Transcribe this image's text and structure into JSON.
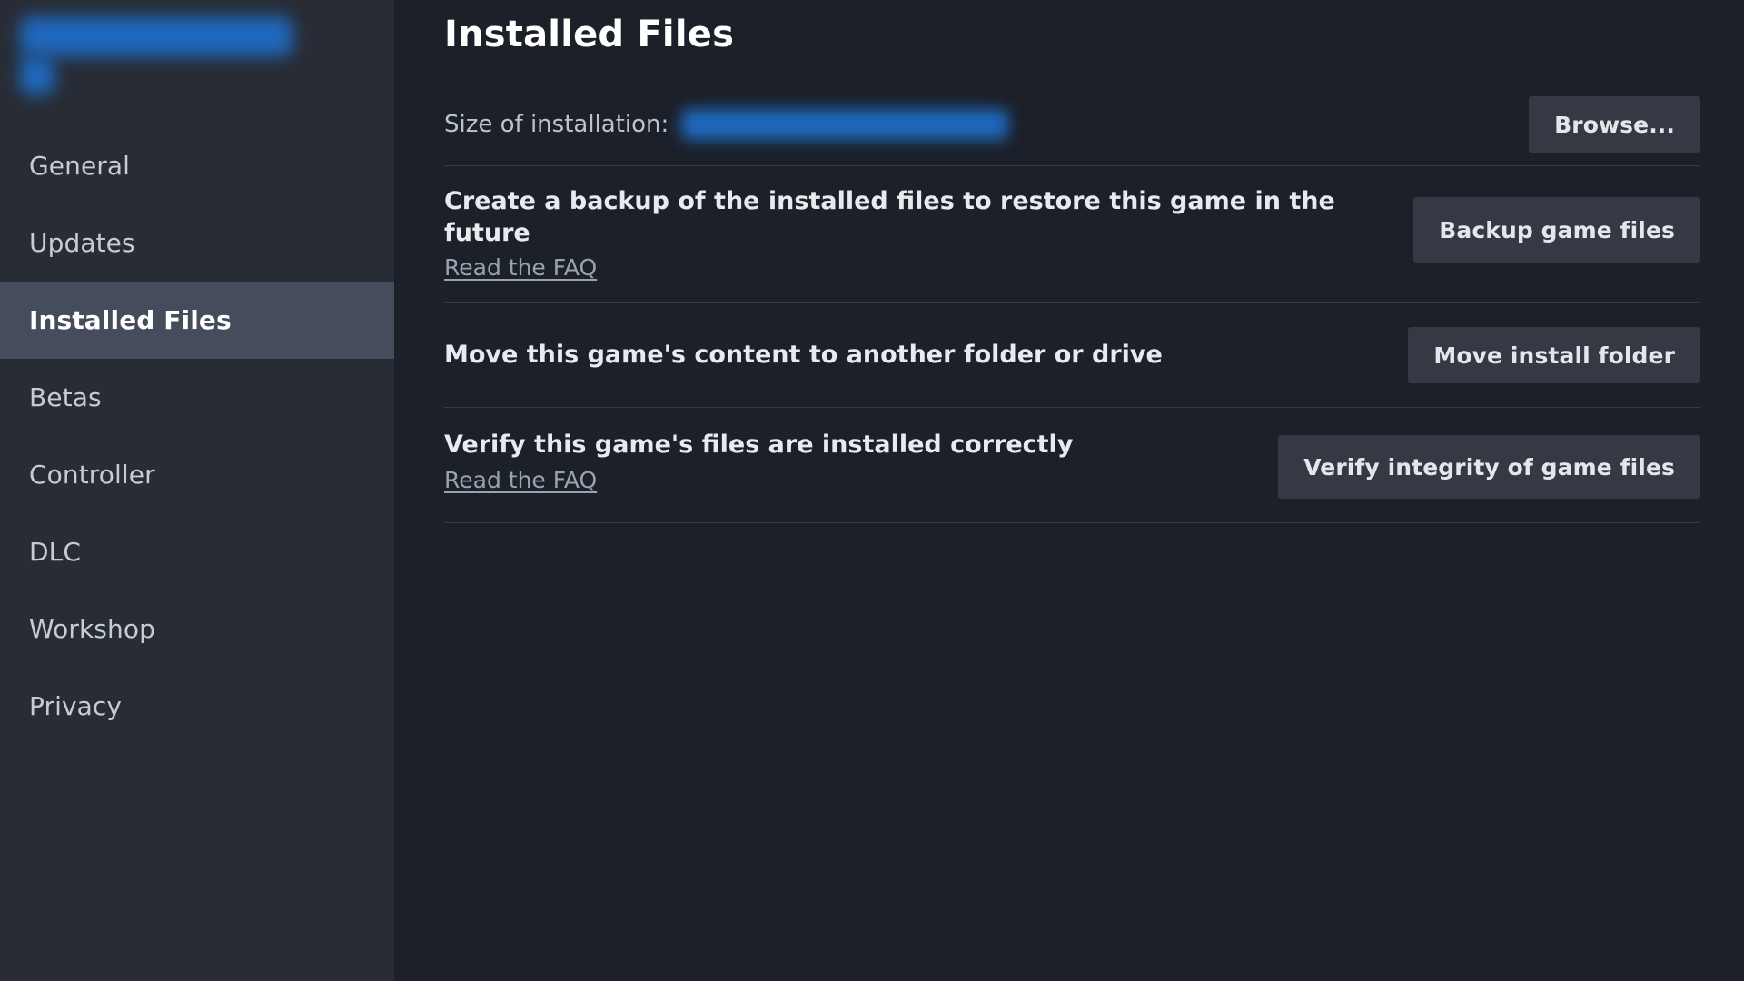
{
  "sidebar": {
    "game_title_redacted": true,
    "items": [
      {
        "label": "General",
        "active": false
      },
      {
        "label": "Updates",
        "active": false
      },
      {
        "label": "Installed Files",
        "active": true
      },
      {
        "label": "Betas",
        "active": false
      },
      {
        "label": "Controller",
        "active": false
      },
      {
        "label": "DLC",
        "active": false
      },
      {
        "label": "Workshop",
        "active": false
      },
      {
        "label": "Privacy",
        "active": false
      }
    ]
  },
  "main": {
    "page_title": "Installed Files",
    "size_row": {
      "label": "Size of installation:",
      "value_redacted": true,
      "browse_button": "Browse..."
    },
    "backup_row": {
      "title": "Create a backup of the installed files to restore this game in the future",
      "faq_link": "Read the FAQ",
      "button": "Backup game files"
    },
    "move_row": {
      "title": "Move this game's content to another folder or drive",
      "button": "Move install folder"
    },
    "verify_row": {
      "title": "Verify this game's files are installed correctly",
      "faq_link": "Read the FAQ",
      "button": "Verify integrity of game files"
    }
  },
  "colors": {
    "main_background": "#1b2029",
    "sidebar_background": "#282c35",
    "sidebar_active": "#454c5c",
    "button_background": "#343943",
    "divider": "#353c48",
    "redaction_blue": "#1f68bd",
    "text_primary": "#e8eaed",
    "text_secondary": "#bcc3cc",
    "link": "#9aa3ad"
  }
}
